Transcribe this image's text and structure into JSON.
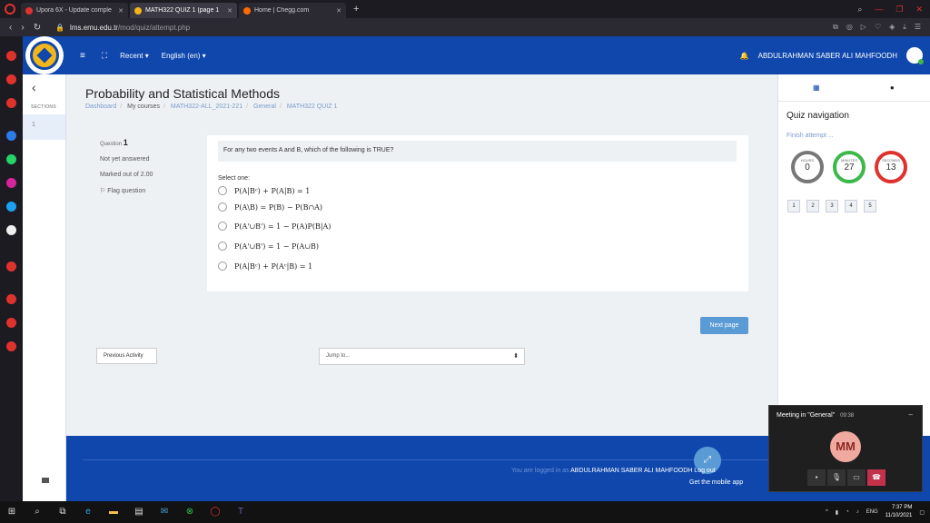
{
  "browser": {
    "tabs": [
      {
        "label": "Upora 6X - Update comple",
        "fav": "#e0322d",
        "active": false
      },
      {
        "label": "MATH322 QUIZ 1 (page 1",
        "fav": "#f2b51a",
        "active": true
      },
      {
        "label": "Home | Chegg.com",
        "fav": "#ff6b00",
        "active": false
      }
    ],
    "new_tab": "+",
    "url_host": "lms.emu.edu.tr",
    "url_path": "/mod/quiz/attempt.php"
  },
  "nav": {
    "recent": "Recent ▾",
    "language": "English (en) ▾",
    "user_name": "ABDULRAHMAN SABER ALI MAHFOODH"
  },
  "drawer": {
    "sections_label": "SECTIONS",
    "section_1": "1"
  },
  "page": {
    "title": "Probability and Statistical Methods",
    "breadcrumbs": [
      "Dashboard",
      "My courses",
      "MATH322-ALL_2021-221",
      "General",
      "MATH322 QUIZ 1"
    ]
  },
  "question": {
    "label": "Question",
    "number": "1",
    "status": "Not yet answered",
    "marks": "Marked out of 2.00",
    "flag": "Flag question",
    "text": "For any two events A and B, which of the following is TRUE?",
    "select_one": "Select one:",
    "options": [
      "P(A|Bᶜ) + P(A|B) = 1",
      "P(A\\B) = P(B) − P(B∩A)",
      "P(A'∪B') = 1 − P(A)P(B|A)",
      "P(A'∪B') = 1 − P(A∪B)",
      "P(A|Bᶜ) + P(Aᶜ|B) = 1"
    ]
  },
  "actions": {
    "next_page": "Next page",
    "previous_activity": "Previous Activity",
    "jump_to": "Jump to..."
  },
  "quiz_nav": {
    "title": "Quiz navigation",
    "finish": "Finish attempt ...",
    "timer": [
      {
        "label": "HOURS",
        "value": "0",
        "color": "#777777"
      },
      {
        "label": "MINUTES",
        "value": "27",
        "color": "#3db84b"
      },
      {
        "label": "SECONDS",
        "value": "13",
        "color": "#e0322d"
      }
    ],
    "question_buttons": [
      "1",
      "2",
      "3",
      "4",
      "5"
    ]
  },
  "footer": {
    "logged_in_prefix": "You are logged in as",
    "logged_in_user": "ABDULRAHMAN SABER ALI MAHFOODH",
    "logout": "Log out",
    "mobile_app": "Get the mobile app"
  },
  "meeting": {
    "title": "Meeting in \"General\"",
    "time": "09:38",
    "initials": "MM"
  },
  "taskbar": {
    "language": "ENG",
    "time": "7:37 PM",
    "date": "11/10/2021"
  }
}
